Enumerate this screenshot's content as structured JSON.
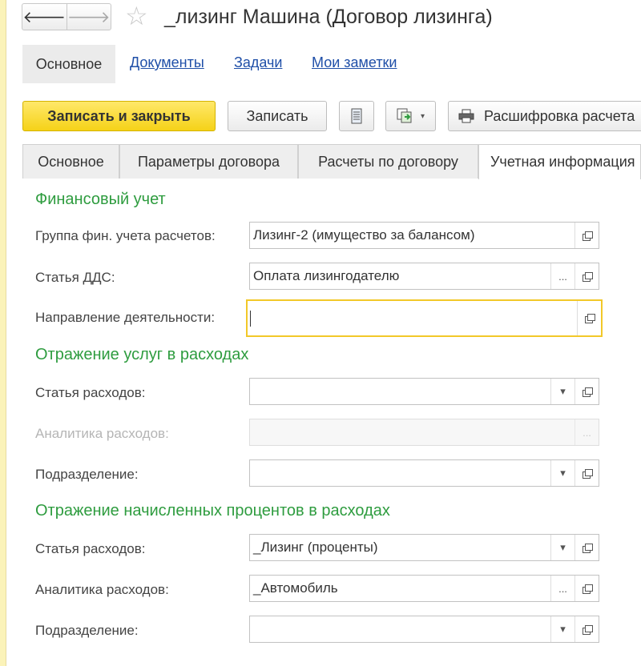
{
  "window": {
    "title": "_лизинг Машина (Договор лизинга)"
  },
  "nav": {
    "back_glyph": "🡐",
    "forward_glyph": "🡒",
    "star_glyph": "☆"
  },
  "sections": {
    "active": "Основное",
    "links": [
      "Документы",
      "Задачи",
      "Мои заметки"
    ]
  },
  "toolbar": {
    "save_close_label": "Записать и закрыть",
    "save_label": "Записать",
    "print_report_label": "Расшифровка расчета"
  },
  "tabs": [
    "Основное",
    "Параметры договора",
    "Расчеты по договору",
    "Учетная информация"
  ],
  "form": {
    "financial": {
      "title": "Финансовый учет",
      "fin_group": {
        "label": "Группа фин. учета расчетов:",
        "value": "Лизинг-2 (имущество за балансом)"
      },
      "dds_item": {
        "label": "Статья ДДС:",
        "value": "Оплата лизингодателю"
      },
      "direction": {
        "label": "Направление деятельности:",
        "value": ""
      }
    },
    "services": {
      "title": "Отражение услуг в расходах",
      "expense_item": {
        "label": "Статья расходов:",
        "value": ""
      },
      "expense_analytics": {
        "label": "Аналитика расходов:",
        "value": ""
      },
      "department": {
        "label": "Подразделение:",
        "value": ""
      }
    },
    "interest": {
      "title": "Отражение начисленных процентов в расходах",
      "expense_item": {
        "label": "Статья расходов:",
        "value": "_Лизинг (проценты)"
      },
      "expense_analytics": {
        "label": "Аналитика расходов:",
        "value": "_Автомобиль"
      },
      "department": {
        "label": "Подразделение:",
        "value": ""
      }
    }
  },
  "glyphs": {
    "ellipsis": "...",
    "dropdown": "▾"
  },
  "colors": {
    "accent_yellow": "#f5d218",
    "group_green": "#2e9c3f",
    "link_blue": "#1f4fa8",
    "focus_border": "#f2c829"
  }
}
